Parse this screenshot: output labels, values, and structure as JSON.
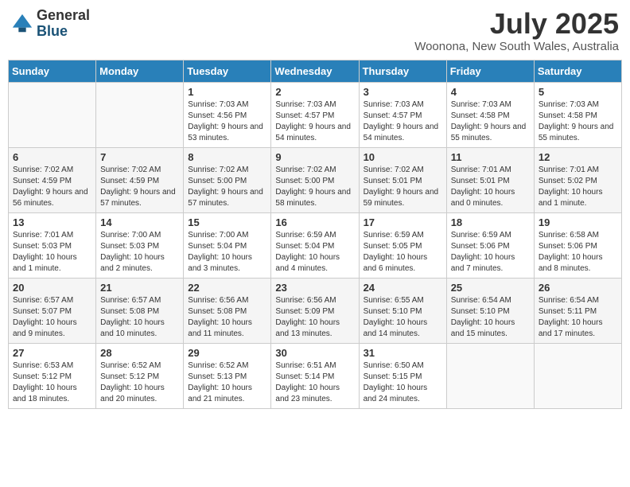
{
  "logo": {
    "general": "General",
    "blue": "Blue"
  },
  "title": "July 2025",
  "location": "Woonona, New South Wales, Australia",
  "headers": [
    "Sunday",
    "Monday",
    "Tuesday",
    "Wednesday",
    "Thursday",
    "Friday",
    "Saturday"
  ],
  "weeks": [
    [
      {
        "day": "",
        "info": ""
      },
      {
        "day": "",
        "info": ""
      },
      {
        "day": "1",
        "info": "Sunrise: 7:03 AM\nSunset: 4:56 PM\nDaylight: 9 hours and 53 minutes."
      },
      {
        "day": "2",
        "info": "Sunrise: 7:03 AM\nSunset: 4:57 PM\nDaylight: 9 hours and 54 minutes."
      },
      {
        "day": "3",
        "info": "Sunrise: 7:03 AM\nSunset: 4:57 PM\nDaylight: 9 hours and 54 minutes."
      },
      {
        "day": "4",
        "info": "Sunrise: 7:03 AM\nSunset: 4:58 PM\nDaylight: 9 hours and 55 minutes."
      },
      {
        "day": "5",
        "info": "Sunrise: 7:03 AM\nSunset: 4:58 PM\nDaylight: 9 hours and 55 minutes."
      }
    ],
    [
      {
        "day": "6",
        "info": "Sunrise: 7:02 AM\nSunset: 4:59 PM\nDaylight: 9 hours and 56 minutes."
      },
      {
        "day": "7",
        "info": "Sunrise: 7:02 AM\nSunset: 4:59 PM\nDaylight: 9 hours and 57 minutes."
      },
      {
        "day": "8",
        "info": "Sunrise: 7:02 AM\nSunset: 5:00 PM\nDaylight: 9 hours and 57 minutes."
      },
      {
        "day": "9",
        "info": "Sunrise: 7:02 AM\nSunset: 5:00 PM\nDaylight: 9 hours and 58 minutes."
      },
      {
        "day": "10",
        "info": "Sunrise: 7:02 AM\nSunset: 5:01 PM\nDaylight: 9 hours and 59 minutes."
      },
      {
        "day": "11",
        "info": "Sunrise: 7:01 AM\nSunset: 5:01 PM\nDaylight: 10 hours and 0 minutes."
      },
      {
        "day": "12",
        "info": "Sunrise: 7:01 AM\nSunset: 5:02 PM\nDaylight: 10 hours and 1 minute."
      }
    ],
    [
      {
        "day": "13",
        "info": "Sunrise: 7:01 AM\nSunset: 5:03 PM\nDaylight: 10 hours and 1 minute."
      },
      {
        "day": "14",
        "info": "Sunrise: 7:00 AM\nSunset: 5:03 PM\nDaylight: 10 hours and 2 minutes."
      },
      {
        "day": "15",
        "info": "Sunrise: 7:00 AM\nSunset: 5:04 PM\nDaylight: 10 hours and 3 minutes."
      },
      {
        "day": "16",
        "info": "Sunrise: 6:59 AM\nSunset: 5:04 PM\nDaylight: 10 hours and 4 minutes."
      },
      {
        "day": "17",
        "info": "Sunrise: 6:59 AM\nSunset: 5:05 PM\nDaylight: 10 hours and 6 minutes."
      },
      {
        "day": "18",
        "info": "Sunrise: 6:59 AM\nSunset: 5:06 PM\nDaylight: 10 hours and 7 minutes."
      },
      {
        "day": "19",
        "info": "Sunrise: 6:58 AM\nSunset: 5:06 PM\nDaylight: 10 hours and 8 minutes."
      }
    ],
    [
      {
        "day": "20",
        "info": "Sunrise: 6:57 AM\nSunset: 5:07 PM\nDaylight: 10 hours and 9 minutes."
      },
      {
        "day": "21",
        "info": "Sunrise: 6:57 AM\nSunset: 5:08 PM\nDaylight: 10 hours and 10 minutes."
      },
      {
        "day": "22",
        "info": "Sunrise: 6:56 AM\nSunset: 5:08 PM\nDaylight: 10 hours and 11 minutes."
      },
      {
        "day": "23",
        "info": "Sunrise: 6:56 AM\nSunset: 5:09 PM\nDaylight: 10 hours and 13 minutes."
      },
      {
        "day": "24",
        "info": "Sunrise: 6:55 AM\nSunset: 5:10 PM\nDaylight: 10 hours and 14 minutes."
      },
      {
        "day": "25",
        "info": "Sunrise: 6:54 AM\nSunset: 5:10 PM\nDaylight: 10 hours and 15 minutes."
      },
      {
        "day": "26",
        "info": "Sunrise: 6:54 AM\nSunset: 5:11 PM\nDaylight: 10 hours and 17 minutes."
      }
    ],
    [
      {
        "day": "27",
        "info": "Sunrise: 6:53 AM\nSunset: 5:12 PM\nDaylight: 10 hours and 18 minutes."
      },
      {
        "day": "28",
        "info": "Sunrise: 6:52 AM\nSunset: 5:12 PM\nDaylight: 10 hours and 20 minutes."
      },
      {
        "day": "29",
        "info": "Sunrise: 6:52 AM\nSunset: 5:13 PM\nDaylight: 10 hours and 21 minutes."
      },
      {
        "day": "30",
        "info": "Sunrise: 6:51 AM\nSunset: 5:14 PM\nDaylight: 10 hours and 23 minutes."
      },
      {
        "day": "31",
        "info": "Sunrise: 6:50 AM\nSunset: 5:15 PM\nDaylight: 10 hours and 24 minutes."
      },
      {
        "day": "",
        "info": ""
      },
      {
        "day": "",
        "info": ""
      }
    ]
  ]
}
